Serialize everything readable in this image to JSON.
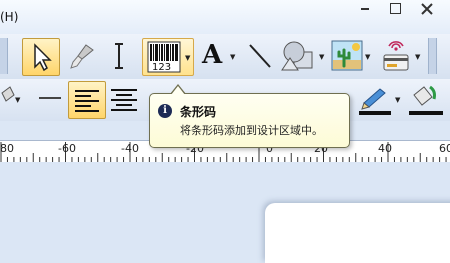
{
  "menubar": {
    "help_label": "(H)"
  },
  "toolbar1": {
    "barcode_caption": "123",
    "text_tool_glyph": "A"
  },
  "tooltip": {
    "title": "条形码",
    "body": "将条形码添加到设计区域中。",
    "icon_glyph": "i"
  },
  "ruler": {
    "labels": [
      "80",
      "-60",
      "-40",
      "-20",
      "0",
      "20",
      "40",
      "60"
    ]
  },
  "colors": {
    "accent": "#ffd56a",
    "tooltip_bg": "#fffff2",
    "toolbar_bg": "#dde7f4"
  }
}
